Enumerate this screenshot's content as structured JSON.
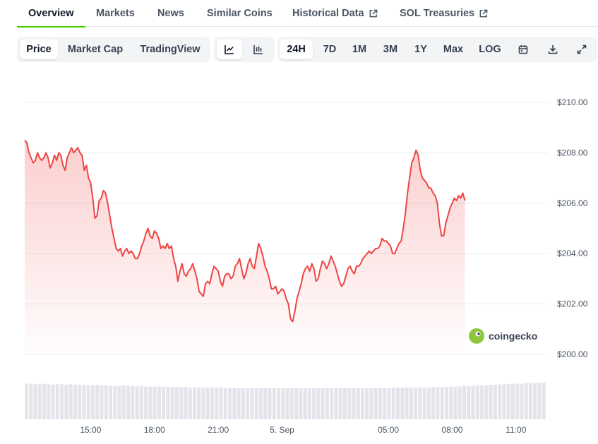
{
  "nav": {
    "tabs": [
      {
        "label": "Overview",
        "active": true
      },
      {
        "label": "Markets"
      },
      {
        "label": "News"
      },
      {
        "label": "Similar Coins"
      },
      {
        "label": "Historical Data",
        "external": true
      },
      {
        "label": "SOL Treasuries",
        "external": true
      }
    ]
  },
  "toolbar": {
    "views": [
      "Price",
      "Market Cap",
      "TradingView"
    ],
    "active_view": "Price",
    "chart_types": [
      "line-chart-icon",
      "ohlc-chart-icon"
    ],
    "active_chart_type": "line-chart-icon",
    "ranges": [
      "24H",
      "7D",
      "1M",
      "3M",
      "1Y",
      "Max",
      "LOG"
    ],
    "active_range": "24H",
    "tools": [
      "calendar-icon",
      "download-icon",
      "fullscreen-icon"
    ]
  },
  "watermark": {
    "text": "coingecko"
  },
  "colors": {
    "line": "#ef4444",
    "accent": "#4bcc00"
  },
  "chart_data": {
    "type": "area",
    "y_ticks": [
      "$210.00",
      "$208.00",
      "$206.00",
      "$204.00",
      "$202.00",
      "$200.00"
    ],
    "x_ticks": [
      {
        "label": "15:00",
        "x": 15
      },
      {
        "label": "18:00",
        "x": 18
      },
      {
        "label": "21:00",
        "x": 21
      },
      {
        "label": "5. Sep",
        "x": 24
      },
      {
        "label": "05:00",
        "x": 29
      },
      {
        "label": "08:00",
        "x": 32
      },
      {
        "label": "11:00",
        "x": 35
      }
    ],
    "ylim": [
      200,
      210
    ],
    "xlim": [
      11.9,
      36.4
    ],
    "series": [
      {
        "values": [
          [
            11.9,
            208.5
          ],
          [
            12.0,
            208.4
          ],
          [
            12.1,
            208.0
          ],
          [
            12.2,
            207.8
          ],
          [
            12.3,
            207.6
          ],
          [
            12.4,
            207.7
          ],
          [
            12.5,
            208.0
          ],
          [
            12.6,
            207.8
          ],
          [
            12.7,
            207.7
          ],
          [
            12.8,
            207.8
          ],
          [
            12.9,
            208.0
          ],
          [
            13.0,
            207.8
          ],
          [
            13.1,
            207.4
          ],
          [
            13.2,
            207.6
          ],
          [
            13.3,
            207.9
          ],
          [
            13.4,
            207.7
          ],
          [
            13.5,
            208.0
          ],
          [
            13.6,
            207.9
          ],
          [
            13.7,
            207.5
          ],
          [
            13.8,
            207.3
          ],
          [
            13.9,
            207.8
          ],
          [
            14.0,
            208.0
          ],
          [
            14.1,
            208.2
          ],
          [
            14.2,
            208.0
          ],
          [
            14.3,
            208.1
          ],
          [
            14.4,
            208.2
          ],
          [
            14.5,
            208.0
          ],
          [
            14.6,
            207.9
          ],
          [
            14.7,
            207.3
          ],
          [
            14.8,
            207.5
          ],
          [
            14.9,
            207.0
          ],
          [
            15.0,
            206.8
          ],
          [
            15.1,
            206.2
          ],
          [
            15.2,
            205.4
          ],
          [
            15.3,
            205.5
          ],
          [
            15.4,
            206.1
          ],
          [
            15.5,
            206.2
          ],
          [
            15.6,
            206.5
          ],
          [
            15.7,
            206.4
          ],
          [
            15.8,
            206.0
          ],
          [
            15.9,
            205.5
          ],
          [
            16.0,
            205.0
          ],
          [
            16.1,
            204.6
          ],
          [
            16.2,
            204.2
          ],
          [
            16.3,
            204.1
          ],
          [
            16.4,
            204.2
          ],
          [
            16.5,
            203.9
          ],
          [
            16.6,
            204.1
          ],
          [
            16.7,
            204.2
          ],
          [
            16.8,
            204.0
          ],
          [
            16.9,
            204.1
          ],
          [
            17.0,
            204.0
          ],
          [
            17.1,
            203.8
          ],
          [
            17.2,
            203.8
          ],
          [
            17.3,
            204.0
          ],
          [
            17.4,
            204.3
          ],
          [
            17.5,
            204.5
          ],
          [
            17.6,
            204.8
          ],
          [
            17.7,
            205.0
          ],
          [
            17.8,
            204.7
          ],
          [
            17.9,
            204.6
          ],
          [
            18.0,
            204.9
          ],
          [
            18.1,
            204.8
          ],
          [
            18.2,
            204.6
          ],
          [
            18.3,
            204.2
          ],
          [
            18.4,
            204.3
          ],
          [
            18.5,
            204.2
          ],
          [
            18.6,
            204.4
          ],
          [
            18.7,
            204.2
          ],
          [
            18.8,
            204.3
          ],
          [
            18.9,
            203.8
          ],
          [
            19.0,
            203.5
          ],
          [
            19.1,
            202.9
          ],
          [
            19.2,
            203.3
          ],
          [
            19.3,
            203.6
          ],
          [
            19.4,
            203.2
          ],
          [
            19.5,
            203.1
          ],
          [
            19.6,
            203.3
          ],
          [
            19.7,
            203.4
          ],
          [
            19.8,
            203.6
          ],
          [
            19.9,
            203.3
          ],
          [
            20.0,
            203.0
          ],
          [
            20.1,
            202.5
          ],
          [
            20.2,
            202.4
          ],
          [
            20.3,
            202.3
          ],
          [
            20.4,
            202.8
          ],
          [
            20.5,
            202.9
          ],
          [
            20.6,
            202.8
          ],
          [
            20.7,
            203.2
          ],
          [
            20.8,
            203.5
          ],
          [
            20.9,
            203.4
          ],
          [
            21.0,
            203.3
          ],
          [
            21.1,
            202.9
          ],
          [
            21.2,
            202.7
          ],
          [
            21.3,
            203.1
          ],
          [
            21.4,
            203.2
          ],
          [
            21.5,
            203.2
          ],
          [
            21.6,
            203.0
          ],
          [
            21.7,
            203.1
          ],
          [
            21.8,
            203.5
          ],
          [
            21.9,
            203.6
          ],
          [
            22.0,
            203.8
          ],
          [
            22.1,
            203.4
          ],
          [
            22.2,
            203.0
          ],
          [
            22.3,
            203.2
          ],
          [
            22.4,
            203.6
          ],
          [
            22.5,
            203.8
          ],
          [
            22.6,
            203.5
          ],
          [
            22.7,
            203.4
          ],
          [
            22.8,
            203.9
          ],
          [
            22.9,
            204.4
          ],
          [
            23.0,
            204.2
          ],
          [
            23.1,
            203.9
          ],
          [
            23.2,
            203.5
          ],
          [
            23.3,
            203.3
          ],
          [
            23.4,
            203.0
          ],
          [
            23.5,
            202.6
          ],
          [
            23.6,
            202.6
          ],
          [
            23.7,
            202.7
          ],
          [
            23.8,
            202.4
          ],
          [
            23.9,
            202.5
          ],
          [
            24.0,
            202.6
          ],
          [
            24.1,
            202.5
          ],
          [
            24.2,
            202.2
          ],
          [
            24.3,
            202.0
          ],
          [
            24.4,
            201.4
          ],
          [
            24.5,
            201.3
          ],
          [
            24.6,
            201.7
          ],
          [
            24.7,
            202.2
          ],
          [
            24.8,
            202.5
          ],
          [
            24.9,
            202.8
          ],
          [
            25.0,
            203.2
          ],
          [
            25.1,
            203.4
          ],
          [
            25.2,
            203.5
          ],
          [
            25.3,
            203.3
          ],
          [
            25.4,
            203.6
          ],
          [
            25.5,
            203.4
          ],
          [
            25.6,
            202.9
          ],
          [
            25.7,
            203.0
          ],
          [
            25.8,
            203.4
          ],
          [
            25.9,
            203.7
          ],
          [
            26.0,
            203.6
          ],
          [
            26.1,
            203.4
          ],
          [
            26.2,
            203.6
          ],
          [
            26.3,
            203.9
          ],
          [
            26.4,
            203.7
          ],
          [
            26.5,
            203.5
          ],
          [
            26.6,
            203.2
          ],
          [
            26.7,
            202.9
          ],
          [
            26.8,
            202.7
          ],
          [
            26.9,
            202.8
          ],
          [
            27.0,
            203.1
          ],
          [
            27.1,
            203.4
          ],
          [
            27.2,
            203.5
          ],
          [
            27.3,
            203.3
          ],
          [
            27.4,
            203.2
          ],
          [
            27.5,
            203.5
          ],
          [
            27.6,
            203.5
          ],
          [
            27.7,
            203.6
          ],
          [
            27.8,
            203.8
          ],
          [
            27.9,
            203.9
          ],
          [
            28.0,
            204.0
          ],
          [
            28.1,
            204.1
          ],
          [
            28.2,
            204.0
          ],
          [
            28.3,
            204.1
          ],
          [
            28.4,
            204.2
          ],
          [
            28.5,
            204.2
          ],
          [
            28.6,
            204.3
          ],
          [
            28.7,
            204.6
          ],
          [
            28.8,
            204.5
          ],
          [
            28.9,
            204.5
          ],
          [
            29.0,
            204.4
          ],
          [
            29.1,
            204.3
          ],
          [
            29.2,
            204.0
          ],
          [
            29.3,
            204.0
          ],
          [
            29.4,
            204.2
          ],
          [
            29.5,
            204.4
          ],
          [
            29.6,
            204.5
          ],
          [
            29.7,
            205.0
          ],
          [
            29.8,
            205.6
          ],
          [
            29.9,
            206.4
          ],
          [
            30.0,
            207.0
          ],
          [
            30.1,
            207.6
          ],
          [
            30.2,
            207.8
          ],
          [
            30.3,
            208.1
          ],
          [
            30.4,
            207.9
          ],
          [
            30.5,
            207.3
          ],
          [
            30.6,
            207.0
          ],
          [
            30.7,
            206.9
          ],
          [
            30.8,
            206.8
          ],
          [
            30.9,
            206.6
          ],
          [
            31.0,
            206.6
          ],
          [
            31.1,
            206.4
          ],
          [
            31.2,
            206.3
          ],
          [
            31.3,
            206.0
          ],
          [
            31.4,
            205.2
          ],
          [
            31.5,
            204.7
          ],
          [
            31.6,
            204.7
          ],
          [
            31.7,
            205.2
          ],
          [
            31.8,
            205.5
          ],
          [
            31.9,
            205.8
          ],
          [
            32.0,
            206.0
          ],
          [
            32.1,
            206.2
          ],
          [
            32.2,
            206.1
          ],
          [
            32.3,
            206.3
          ],
          [
            32.4,
            206.2
          ],
          [
            32.5,
            206.4
          ],
          [
            32.6,
            206.1
          ]
        ]
      }
    ],
    "volumes": [
      0.62,
      0.62,
      0.61,
      0.61,
      0.62,
      0.61,
      0.6,
      0.61,
      0.61,
      0.6,
      0.61,
      0.6,
      0.6,
      0.6,
      0.59,
      0.59,
      0.6,
      0.59,
      0.59,
      0.58,
      0.58,
      0.58,
      0.59,
      0.58,
      0.58,
      0.57,
      0.58,
      0.57,
      0.57,
      0.57,
      0.57,
      0.56,
      0.57,
      0.56,
      0.56,
      0.56,
      0.56,
      0.55,
      0.56,
      0.55,
      0.55,
      0.55,
      0.55,
      0.55,
      0.55,
      0.54,
      0.55,
      0.54,
      0.54,
      0.54,
      0.54,
      0.54,
      0.54,
      0.54,
      0.54,
      0.54,
      0.54,
      0.54,
      0.54,
      0.54,
      0.54,
      0.54,
      0.54,
      0.54,
      0.54,
      0.54,
      0.54,
      0.54,
      0.54,
      0.54,
      0.54,
      0.54,
      0.54,
      0.54,
      0.54,
      0.54,
      0.54,
      0.54,
      0.54,
      0.54,
      0.54,
      0.54,
      0.54,
      0.55,
      0.55,
      0.55,
      0.55,
      0.55,
      0.55,
      0.55,
      0.55,
      0.55,
      0.56,
      0.56,
      0.56,
      0.56,
      0.57,
      0.57,
      0.57,
      0.58,
      0.58,
      0.58,
      0.59,
      0.59,
      0.59,
      0.6,
      0.6,
      0.61,
      0.61,
      0.61,
      0.62,
      0.62,
      0.62,
      0.63,
      0.63,
      0.63,
      0.64,
      0.64
    ]
  }
}
